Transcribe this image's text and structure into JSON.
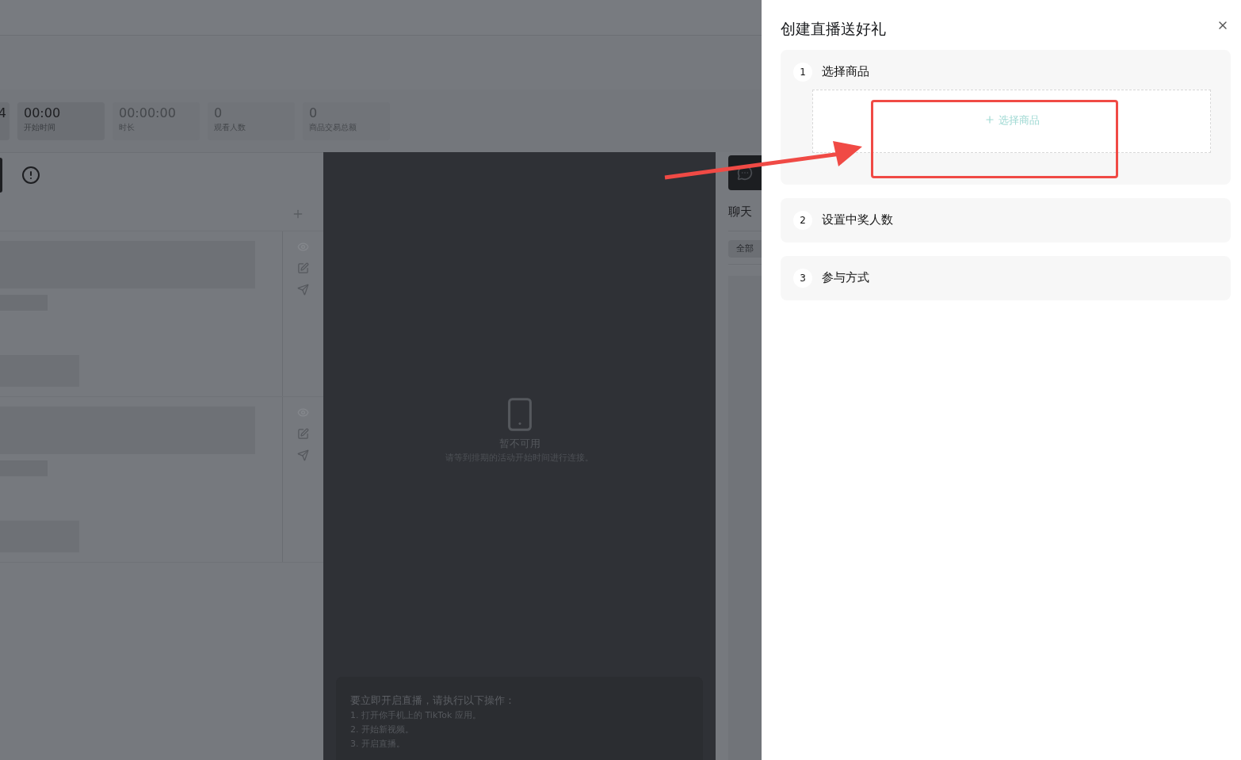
{
  "stats": [
    {
      "value": "4",
      "active": true
    },
    {
      "value": "00:00",
      "label": "开始时间",
      "active": true
    },
    {
      "value": "00:00:00",
      "label": "时长",
      "active": false
    },
    {
      "value": "0",
      "label": "观看人数",
      "active": false
    },
    {
      "value": "0",
      "label": "商品交易总额",
      "active": false
    }
  ],
  "preview": {
    "title": "暂不可用",
    "subtitle": "请等到排期的活动开始时间进行连接。"
  },
  "instructions": {
    "heading": "要立即开启直播，请执行以下操作：",
    "steps": [
      "1. 打开你手机上的 TikTok 应用。",
      "2. 开始新视频。",
      "3. 开启直播。"
    ]
  },
  "chat": {
    "title": "聊天",
    "filter": "全部"
  },
  "drawer": {
    "title": "创建直播送好礼",
    "steps": [
      {
        "number": "1",
        "title": "选择商品",
        "expanded": true,
        "action": "选择商品"
      },
      {
        "number": "2",
        "title": "设置中奖人数",
        "expanded": false
      },
      {
        "number": "3",
        "title": "参与方式",
        "expanded": false
      }
    ]
  }
}
